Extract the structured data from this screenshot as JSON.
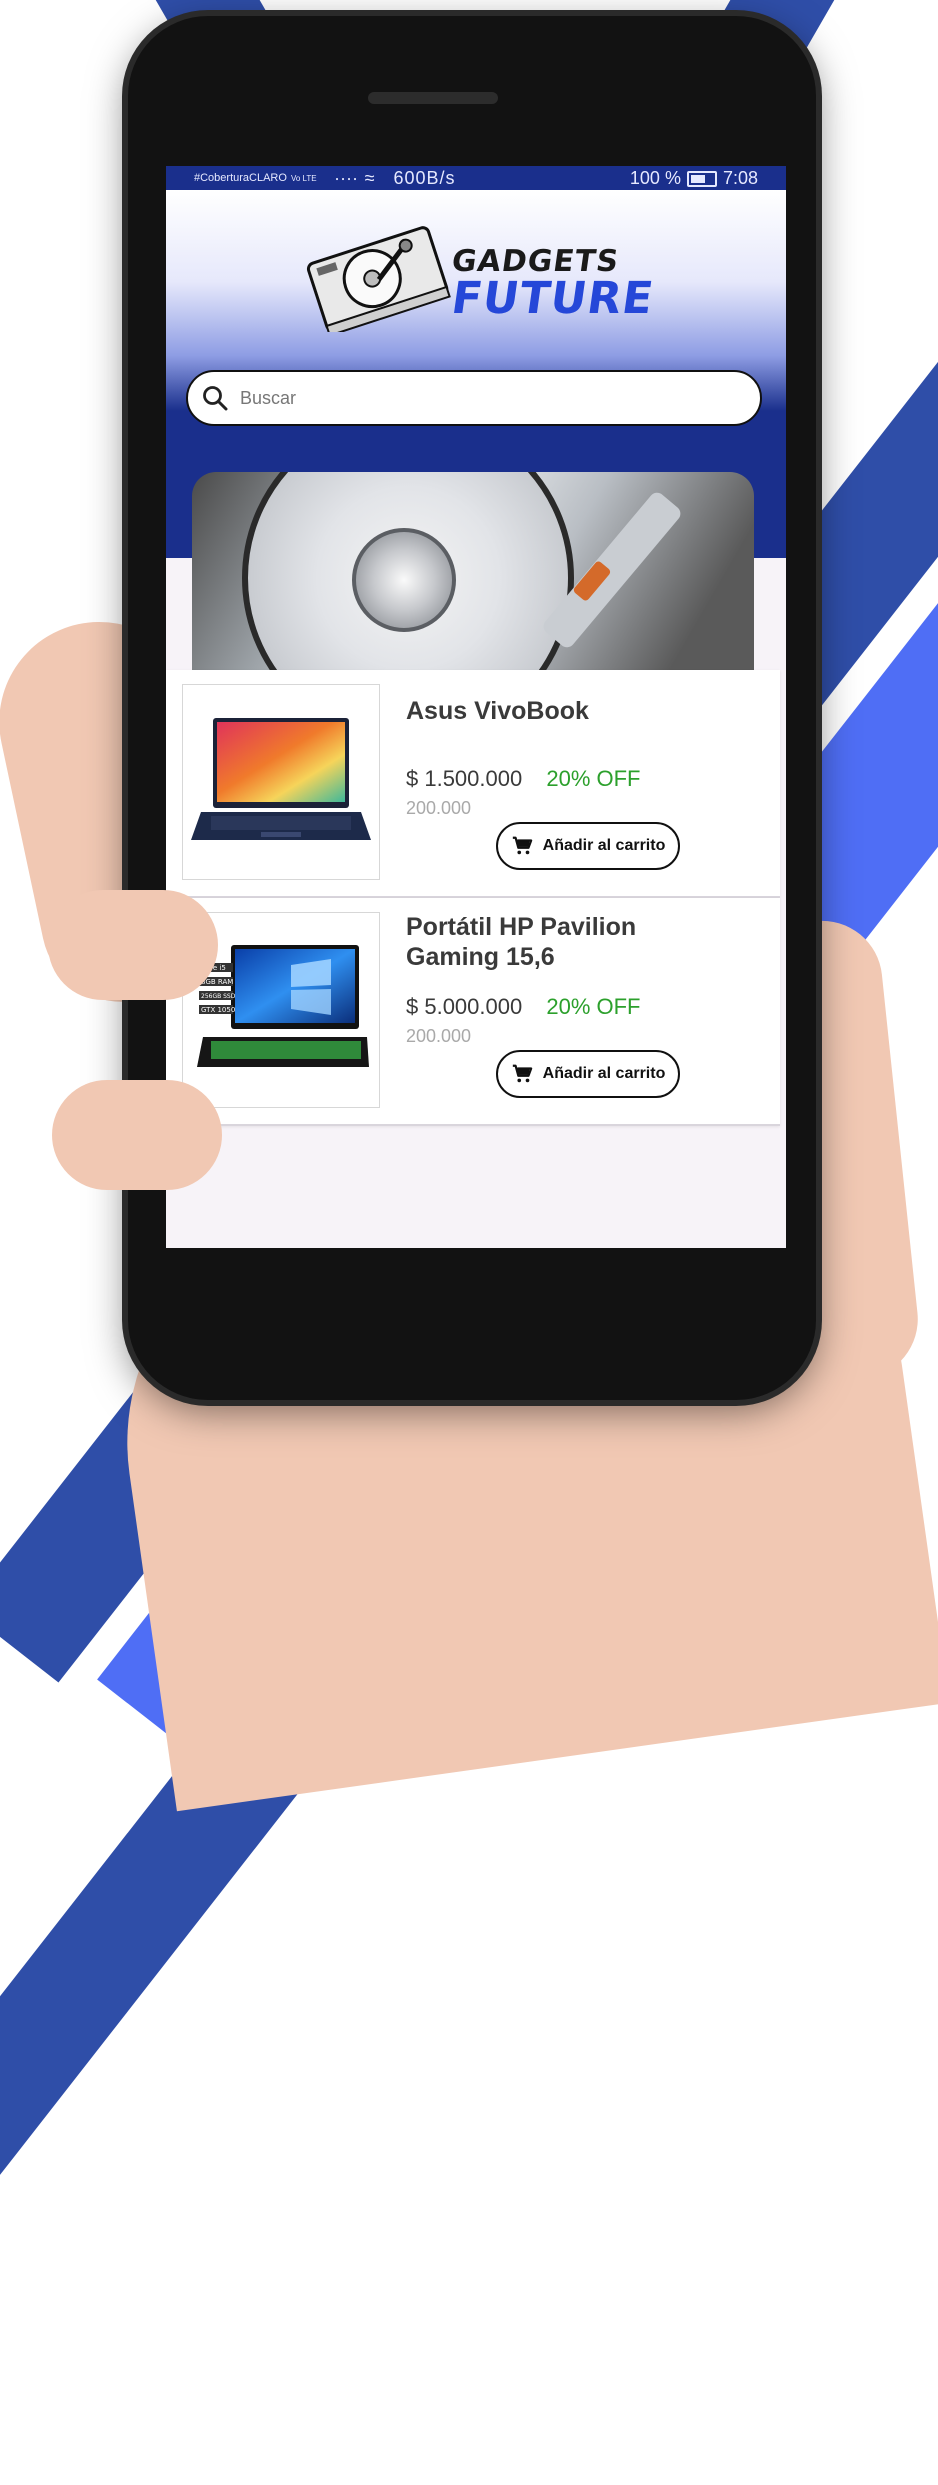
{
  "status_bar": {
    "carrier": "#CoberturaCLARO",
    "network": "Vo LTE",
    "speed": "600B/s",
    "battery": "100 %",
    "time": "7:08"
  },
  "brand": {
    "line1": "GADGETS",
    "line2": "FUTURE"
  },
  "search": {
    "placeholder": "Buscar"
  },
  "carousel": {
    "active_index": 0,
    "dots": 3
  },
  "products": [
    {
      "name": "Asus VivoBook",
      "price": "$ 1.500.000",
      "discount": "20% OFF",
      "old_price": "200.000",
      "cart_label": "Añadir al carrito"
    },
    {
      "name": "Portátil HP Pavilion Gaming 15,6",
      "price": "$ 5.000.000",
      "discount": "20% OFF",
      "old_price": "200.000",
      "cart_label": "Añadir al carrito",
      "spec_labels": [
        "Core i5",
        "8GB RAM",
        "256GB SSD",
        "GTX 1050"
      ]
    }
  ],
  "colors": {
    "primary": "#1a2f8c",
    "accent_blue": "#2547d8",
    "discount_green": "#2ca02c",
    "stripe_blue": "#4f6ef5"
  }
}
